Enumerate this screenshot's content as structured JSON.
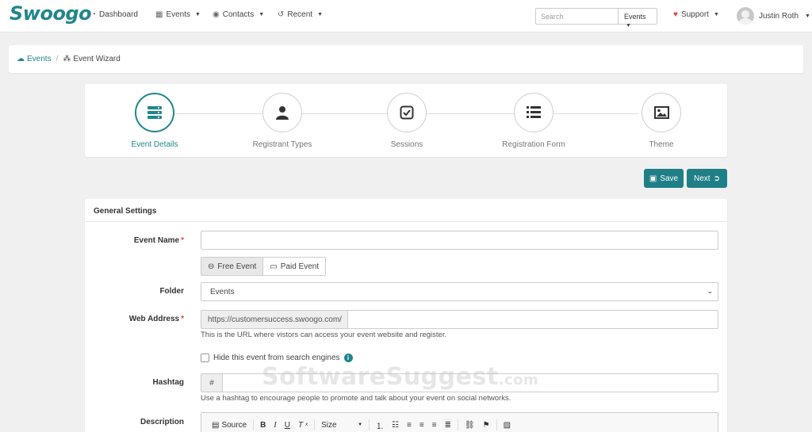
{
  "app": {
    "logo": "Swoogo"
  },
  "nav": {
    "dashboard": "Dashboard",
    "events": "Events",
    "contacts": "Contacts",
    "recent": "Recent",
    "search_placeholder": "Search",
    "search_scope": "Events",
    "support": "Support",
    "user_name": "Justin Roth"
  },
  "breadcrumb": {
    "root": "Events",
    "current": "Event Wizard"
  },
  "wizard": {
    "steps": [
      {
        "label": "Event Details",
        "icon": "server-icon",
        "active": true
      },
      {
        "label": "Registrant Types",
        "icon": "user-icon",
        "active": false
      },
      {
        "label": "Sessions",
        "icon": "check-square-icon",
        "active": false
      },
      {
        "label": "Registration Form",
        "icon": "list-icon",
        "active": false
      },
      {
        "label": "Theme",
        "icon": "image-icon",
        "active": false
      }
    ]
  },
  "actions": {
    "save": "Save",
    "next": "Next"
  },
  "form": {
    "section_title": "General Settings",
    "event_name_label": "Event Name",
    "event_name_value": "",
    "free_event": "Free Event",
    "paid_event": "Paid Event",
    "folder_label": "Folder",
    "folder_value": "Events",
    "web_address_label": "Web Address",
    "web_address_prefix": "https://customersuccess.swoogo.com/",
    "web_address_value": "",
    "web_address_help": "This is the URL where vistors can access your event website and register.",
    "hide_search_label": "Hide this event from search engines",
    "hashtag_label": "Hashtag",
    "hashtag_prefix": "#",
    "hashtag_value": "",
    "hashtag_help": "Use a hashtag to encourage people to promote and talk about your event on social networks.",
    "description_label": "Description",
    "editor": {
      "source": "Source",
      "size": "Size"
    }
  },
  "watermark": {
    "text": "SoftwareSuggest",
    "suffix": ".com"
  },
  "colors": {
    "accent": "#20868c",
    "button": "#1f7f87",
    "required": "#d64848"
  }
}
